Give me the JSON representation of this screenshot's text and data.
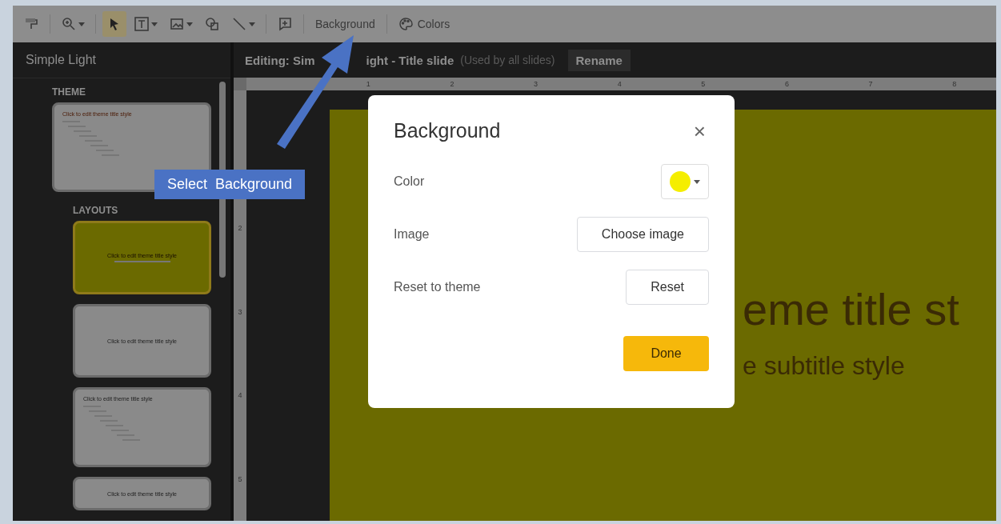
{
  "toolbar": {
    "tools": [
      {
        "kind": "paint-format",
        "selected": false,
        "caret": false
      },
      {
        "kind": "zoom",
        "selected": false,
        "caret": true
      },
      {
        "kind": "select",
        "selected": true,
        "caret": false
      },
      {
        "kind": "textbox",
        "selected": false,
        "caret": true
      },
      {
        "kind": "image",
        "selected": false,
        "caret": true
      },
      {
        "kind": "shape",
        "selected": false,
        "caret": false
      },
      {
        "kind": "line",
        "selected": false,
        "caret": true
      },
      {
        "kind": "comment",
        "selected": false,
        "caret": false
      }
    ],
    "buttons": [
      {
        "kind": "text",
        "label": "Background"
      },
      {
        "kind": "palette",
        "label": "Colors"
      }
    ]
  },
  "sidebar": {
    "title": "Simple Light",
    "theme_heading": "THEME",
    "theme": {
      "title": "Click to edit theme title style",
      "kind": "outline"
    },
    "layouts_heading": "LAYOUTS",
    "layouts": [
      {
        "title": "Click to edit theme title style",
        "kind": "subtitle",
        "selected": true
      },
      {
        "title": "Click to edit theme title style",
        "kind": "plain",
        "selected": false
      },
      {
        "title": "Click to edit theme title style",
        "kind": "outline",
        "selected": false
      },
      {
        "title": "Click to edit theme title style",
        "kind": "plain",
        "selected": false
      }
    ]
  },
  "editor": {
    "heading": [
      "Editing: Sim",
      "ight - Title slide"
    ],
    "note": "(Used by all slides)",
    "rename": "Rename",
    "ruler": [
      "1",
      "2",
      "3",
      "4",
      "5",
      "6",
      "7",
      "8"
    ],
    "vruler": [
      "2",
      "3",
      "4",
      "5"
    ],
    "slide": {
      "title": "eme title st",
      "subtitle": "e subtitle style"
    }
  },
  "callout": {
    "text": "Select  Background"
  },
  "dialog": {
    "title": "Background",
    "close": "×",
    "rows": [
      {
        "kind": "color",
        "label": "Color",
        "color": "#f5ee00"
      },
      {
        "kind": "button",
        "label": "Image",
        "button": "Choose image"
      },
      {
        "kind": "button",
        "label": "Reset to theme",
        "button": "Reset"
      }
    ],
    "done": "Done"
  }
}
